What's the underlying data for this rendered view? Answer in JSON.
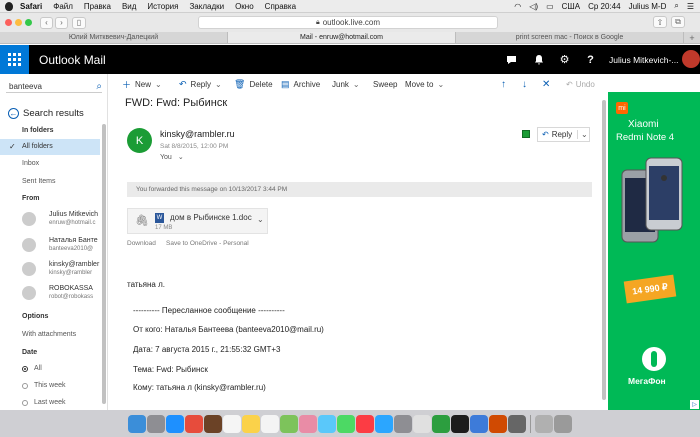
{
  "menubar": {
    "app": "Safari",
    "items": [
      "Файл",
      "Правка",
      "Вид",
      "История",
      "Закладки",
      "Окно",
      "Справка"
    ],
    "input_source": "США",
    "clock": "Ср 20:44",
    "user": "Julius M-D"
  },
  "browser": {
    "url": "outlook.live.com",
    "tabs": [
      "Юлий Митквевич-Далецкий",
      "Mail - enruw@hotmail.com",
      "print screen mac - Поиск в Google"
    ]
  },
  "header": {
    "app_name": "Outlook Mail",
    "user_name": "Julius Mitkevich-..."
  },
  "sidebar": {
    "search_value": "banteeva",
    "search_results_title": "Search results",
    "in_folders_label": "In folders",
    "folders": [
      "All folders",
      "Inbox",
      "Sent Items"
    ],
    "from_label": "From",
    "contacts": [
      {
        "name": "Julius Mitkevich",
        "email": "enruw@hotmail.c"
      },
      {
        "name": "Наталья Банте",
        "email": "banteeva2010@"
      },
      {
        "name": "kinsky@rambler",
        "email": "kinsky@rambler"
      },
      {
        "name": "ROBOKASSA",
        "email": "robot@robokass"
      }
    ],
    "options_label": "Options",
    "with_attachments": "With attachments",
    "date_label": "Date",
    "date_options": [
      "All",
      "This week",
      "Last week"
    ]
  },
  "commands": {
    "new": "New",
    "reply": "Reply",
    "delete": "Delete",
    "archive": "Archive",
    "junk": "Junk",
    "sweep": "Sweep",
    "move_to": "Move to",
    "undo": "Undo"
  },
  "message": {
    "subject": "FWD: Fwd: Рыбинск",
    "avatar_letter": "K",
    "from": "kinsky@rambler.ru",
    "date": "Sat 8/8/2015, 12:00 PM",
    "to": "You",
    "reply_label": "Reply",
    "forwarded_notice": "You forwarded this message on 10/13/2017 3:44 PM",
    "attachment_name": "дом в Рыбинске 1.doc",
    "attachment_size": "17 MB",
    "download_label": "Download",
    "save_label": "Save to OneDrive - Personal",
    "body": [
      "татьяна л.",
      "---------- Пересланное сообщение ----------",
      "От кого: Наталья Бантеева (banteeva2010@mail.ru)",
      "Дата: 7 августа 2015 г., 21:55:32 GMT+3",
      "Тема: Fwd: Рыбинск",
      "Кому: татьяна л (kinsky@rambler.ru)"
    ]
  },
  "ad": {
    "brand": "Xiaomi",
    "model": "Redmi Note 4",
    "price": "14 990 ₽",
    "operator": "МегаФон",
    "mi_logo": "mi",
    "colors": {
      "background": "#00b956",
      "price_bg": "#f5a623"
    }
  },
  "colors": {
    "accent": "#0078d7",
    "header_bg": "#000000",
    "avatar_green": "#1b9c35"
  }
}
